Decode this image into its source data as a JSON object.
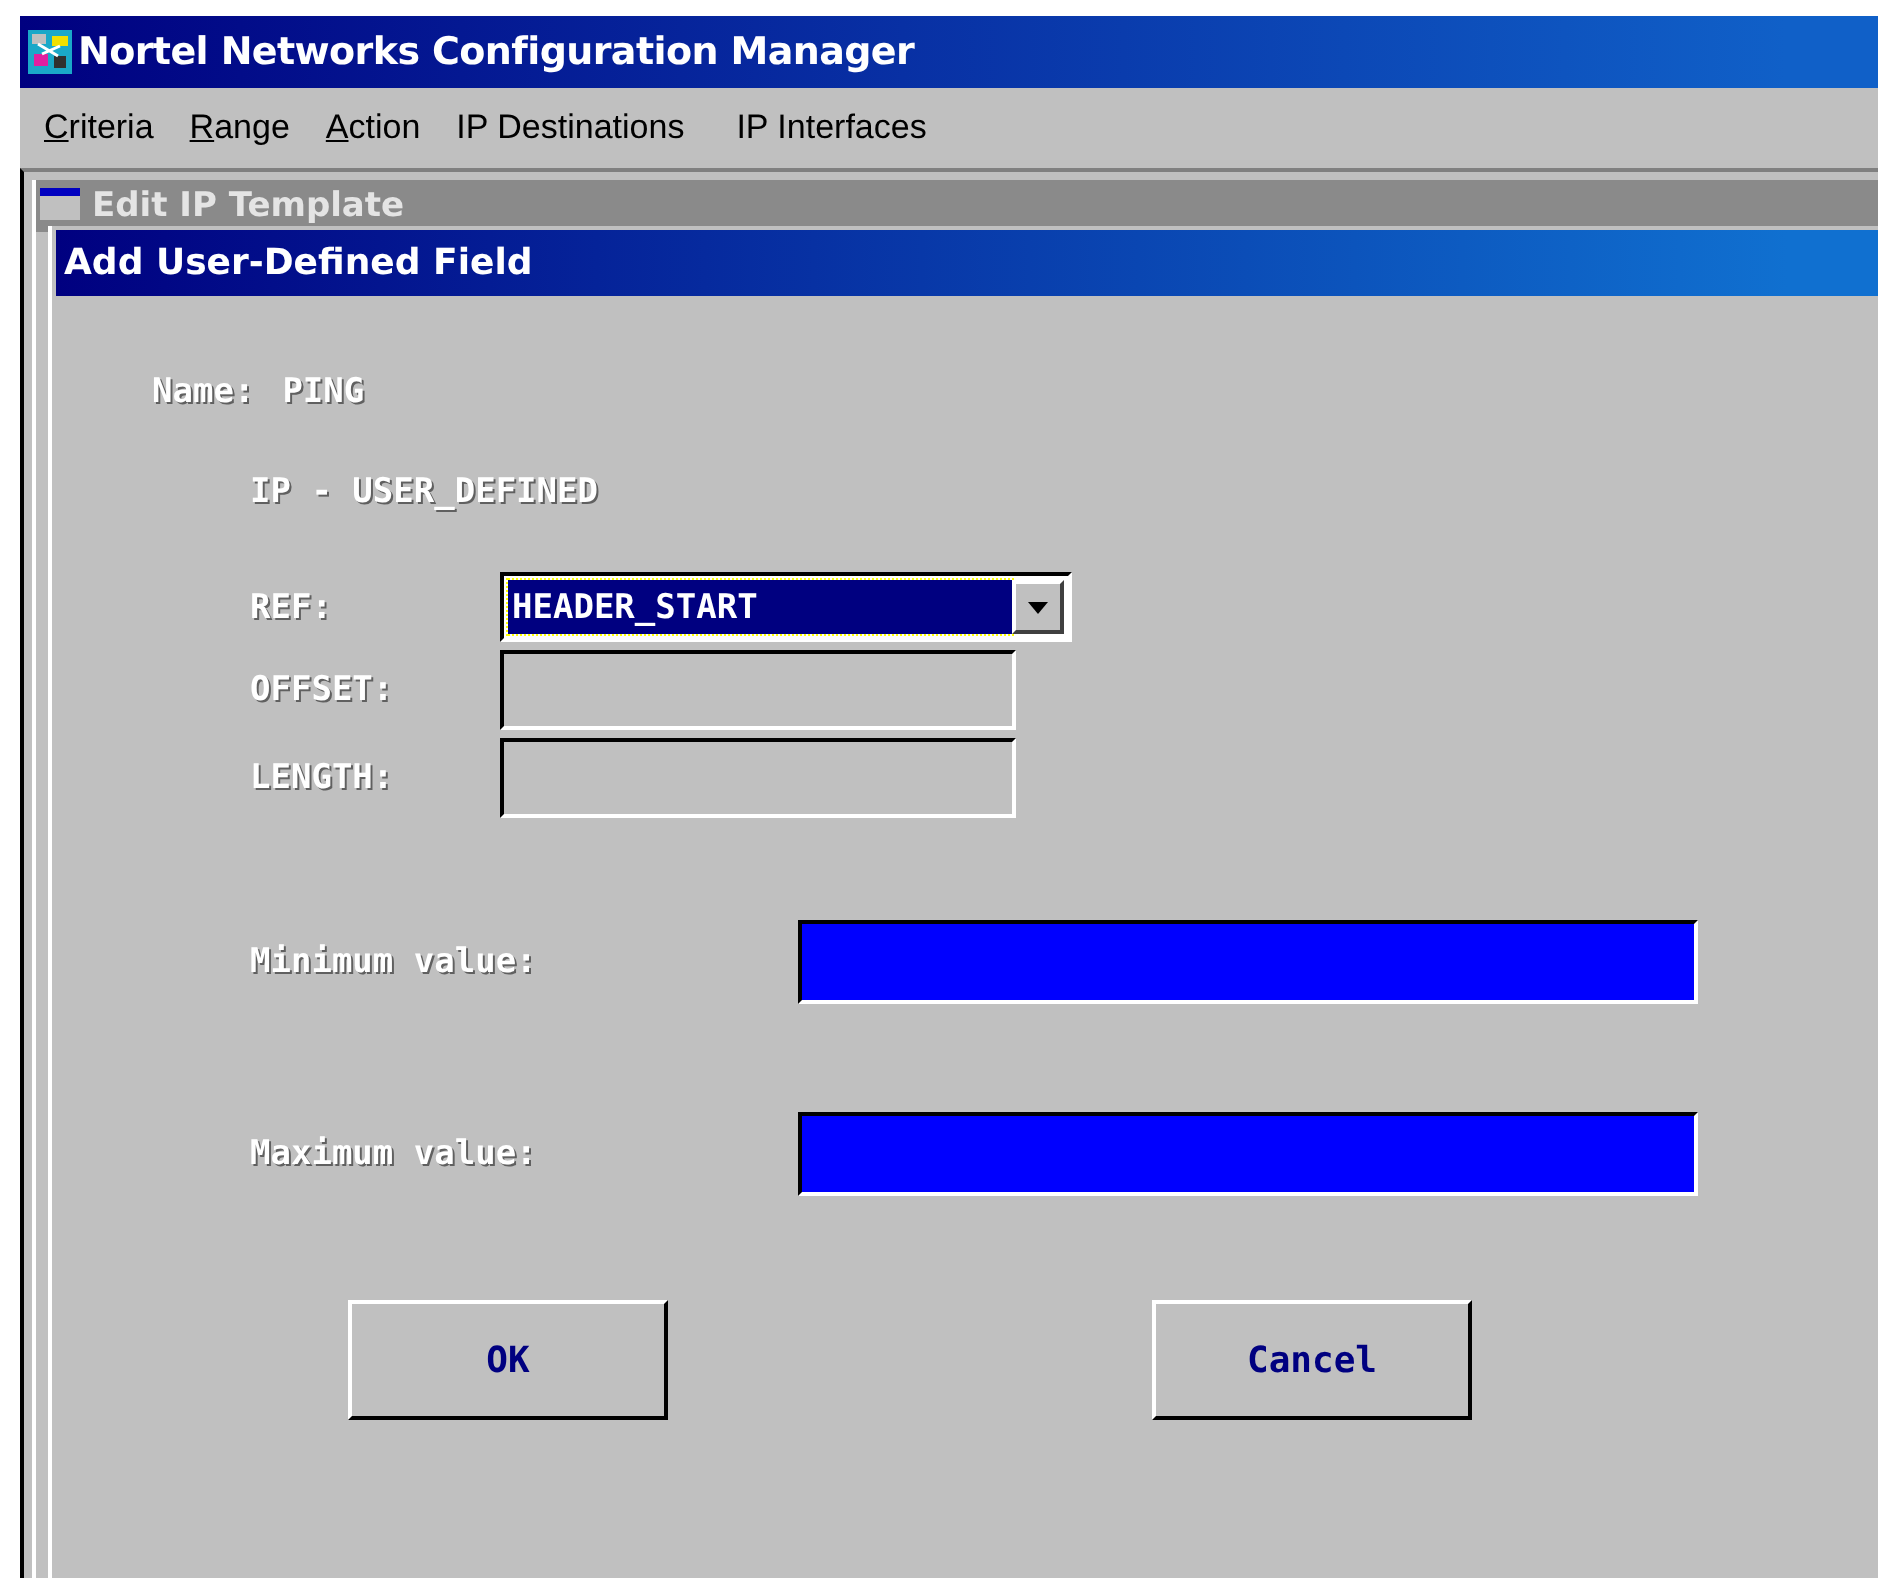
{
  "window": {
    "title": "Nortel Networks Configuration Manager"
  },
  "menu": [
    {
      "label": "Criteria",
      "mnemonic": true
    },
    {
      "label": "Range",
      "mnemonic": true
    },
    {
      "label": "Action",
      "mnemonic": true
    },
    {
      "label": "IP Destinations",
      "mnemonic": false
    },
    {
      "label": "IP Interfaces",
      "mnemonic": false
    }
  ],
  "child_window": {
    "title": "Edit IP Template"
  },
  "dialog": {
    "title": "Add User-Defined Field",
    "name_label": "Name:",
    "name_value": "PING",
    "subtitle": "IP - USER_DEFINED",
    "ref": {
      "label": "REF:",
      "value": "HEADER_START"
    },
    "offset": {
      "label": "OFFSET:",
      "disabled": true
    },
    "length": {
      "label": "LENGTH:",
      "disabled": true
    },
    "minimum": {
      "label": "Minimum value:"
    },
    "maximum": {
      "label": "Maximum value:"
    },
    "buttons": [
      "OK",
      "Cancel"
    ]
  }
}
